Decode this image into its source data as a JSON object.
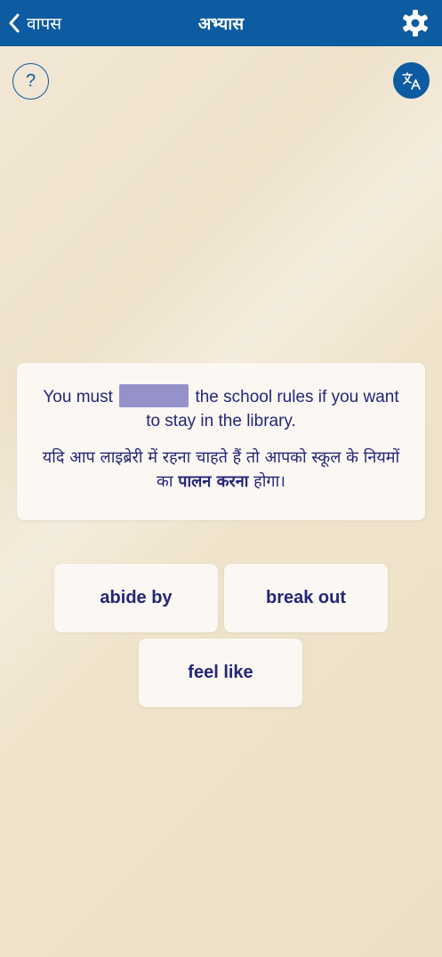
{
  "header": {
    "back_label": "वापस",
    "title": "अभ्यास"
  },
  "icons": {
    "back": "chevron-left-icon",
    "settings": "gear-icon",
    "help": "question-mark-icon",
    "translate": "translate-icon"
  },
  "help_label": "?",
  "colors": {
    "header_bg": "#0d5ba0",
    "text_primary": "#25267a",
    "blank_fill": "#9591c9",
    "card_bg": "#fbf8f3"
  },
  "exercise": {
    "sentence_before": "You must",
    "sentence_after": "the school rules if you want to stay in the library.",
    "hindi_before": "यदि आप लाइब्रेरी में रहना चाहते हैं तो आपको स्कूल के नियमों का",
    "hindi_bold": "पालन करना",
    "hindi_after": "होगा।"
  },
  "options": [
    {
      "label": "abide by"
    },
    {
      "label": "break out"
    },
    {
      "label": "feel like"
    }
  ]
}
